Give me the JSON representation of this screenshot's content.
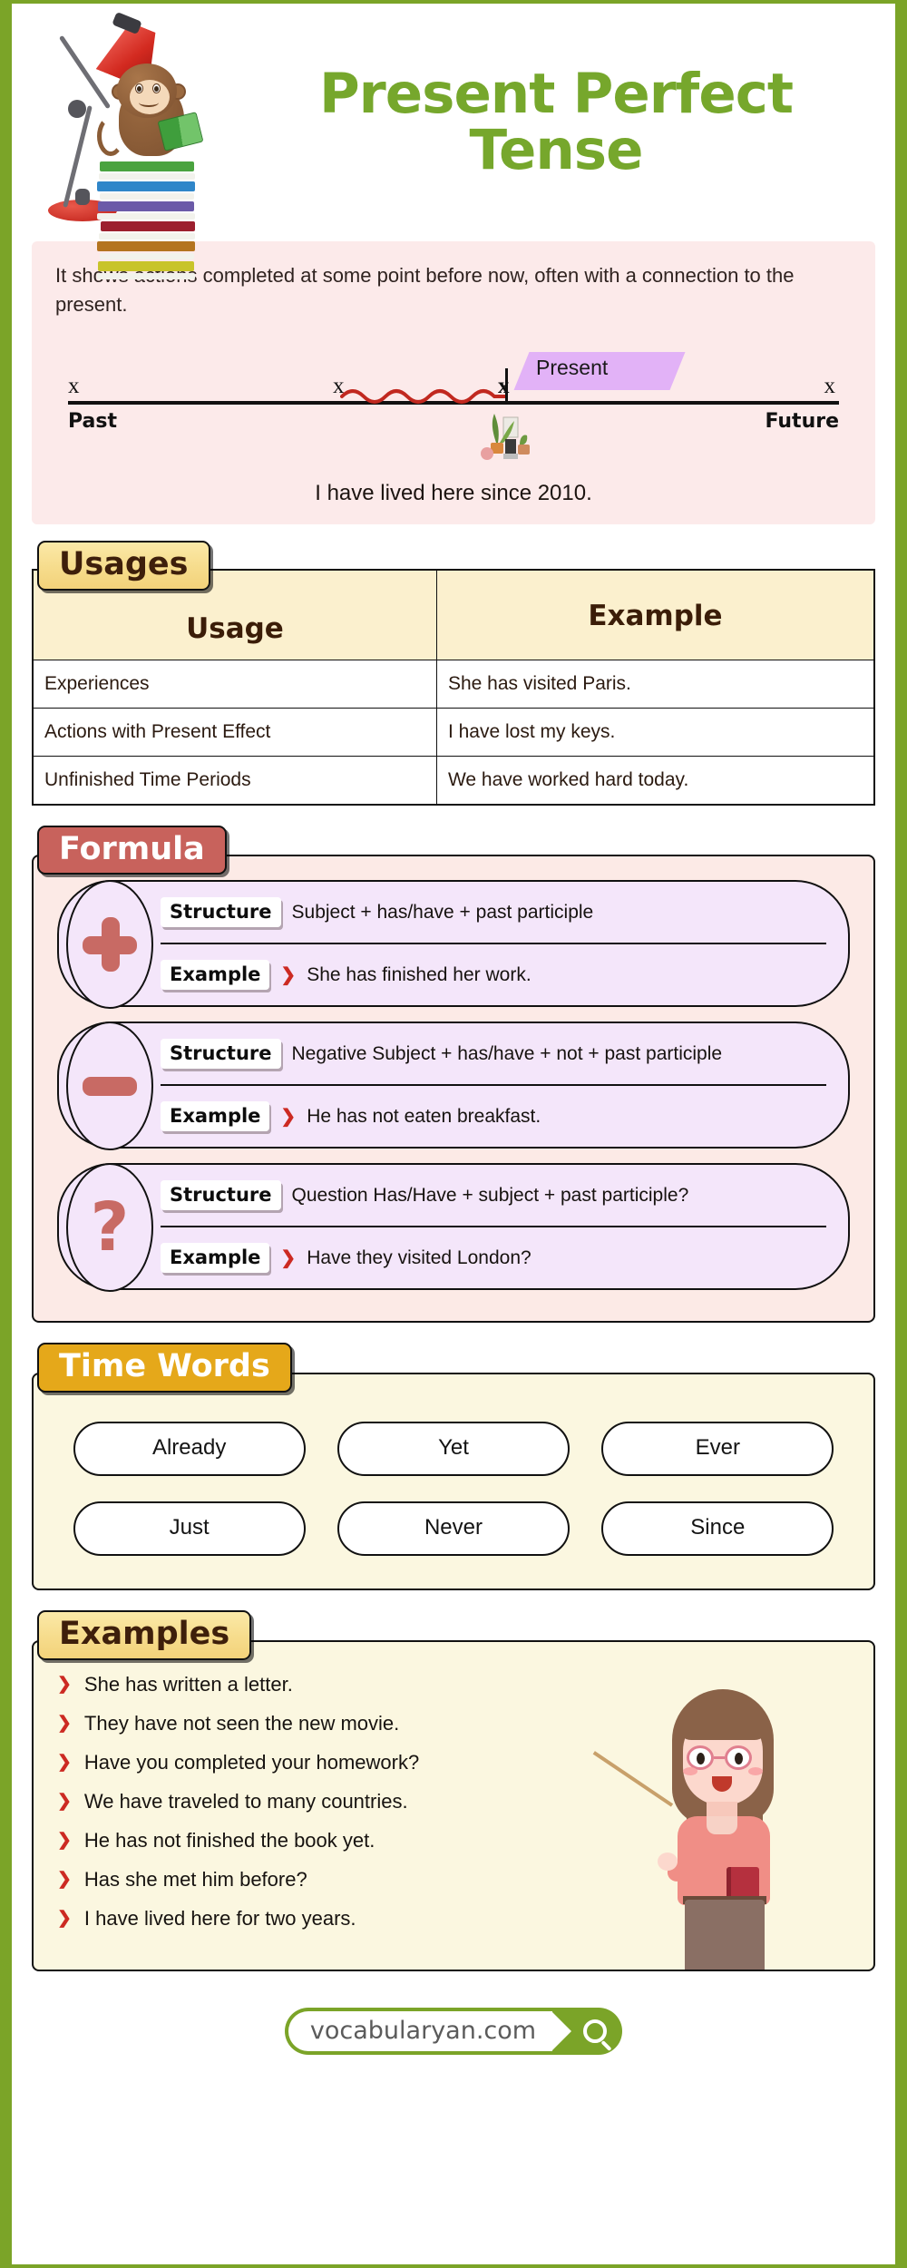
{
  "colors": {
    "brand_green": "#7ba428",
    "title_green": "#76a72c",
    "badge_red": "#c8625c",
    "badge_gold": "#e5a81a",
    "badge_yellow": "#f6dc8c",
    "desc_bg": "#fceaea",
    "formula_bg": "#fceae6",
    "formula_card_bg": "#f4e6fa",
    "timewords_bg": "#fbf7e0",
    "present_banner": "#e2b2f7",
    "bullet_red": "#cc2a22"
  },
  "header": {
    "title_line1": "Present Perfect",
    "title_line2": "Tense"
  },
  "description": {
    "text": "It shows actions completed at some point before now, often with a connection to the present."
  },
  "timeline": {
    "x_marks": [
      "x",
      "x",
      "x",
      "x"
    ],
    "past_label": "Past",
    "future_label": "Future",
    "present_label": "Present",
    "caption": "I have lived here since 2010."
  },
  "usages": {
    "badge": "Usages",
    "columns": [
      "Usage",
      "Example"
    ],
    "rows": [
      {
        "usage": "Experiences",
        "example": "She has visited Paris."
      },
      {
        "usage": "Actions with Present Effect",
        "example": "I have lost my keys."
      },
      {
        "usage": "Unfinished Time Periods",
        "example": "We have worked hard today."
      }
    ]
  },
  "formula": {
    "badge": "Formula",
    "structure_tag": "Structure",
    "example_tag": "Example",
    "cards": [
      {
        "icon": "plus-icon",
        "structure": "Subject + has/have + past participle",
        "example": "She has finished her work."
      },
      {
        "icon": "minus-icon",
        "structure": "Negative Subject + has/have + not + past participle",
        "example": "He has not eaten breakfast."
      },
      {
        "icon": "question-mark-icon",
        "structure": "Question Has/Have + subject + past participle?",
        "example": "Have they visited London?"
      }
    ]
  },
  "time_words": {
    "badge": "Time Words",
    "words": [
      "Already",
      "Yet",
      "Ever",
      "Just",
      "Never",
      "Since"
    ]
  },
  "examples": {
    "badge": "Examples",
    "items": [
      "She has written a letter.",
      "They have not seen the new movie.",
      "Have you completed your homework?",
      "We have traveled to many countries.",
      "He has not finished the book yet.",
      "Has she met him before?",
      "I have lived here for two years."
    ]
  },
  "footer": {
    "site": "vocabularyan.com"
  }
}
